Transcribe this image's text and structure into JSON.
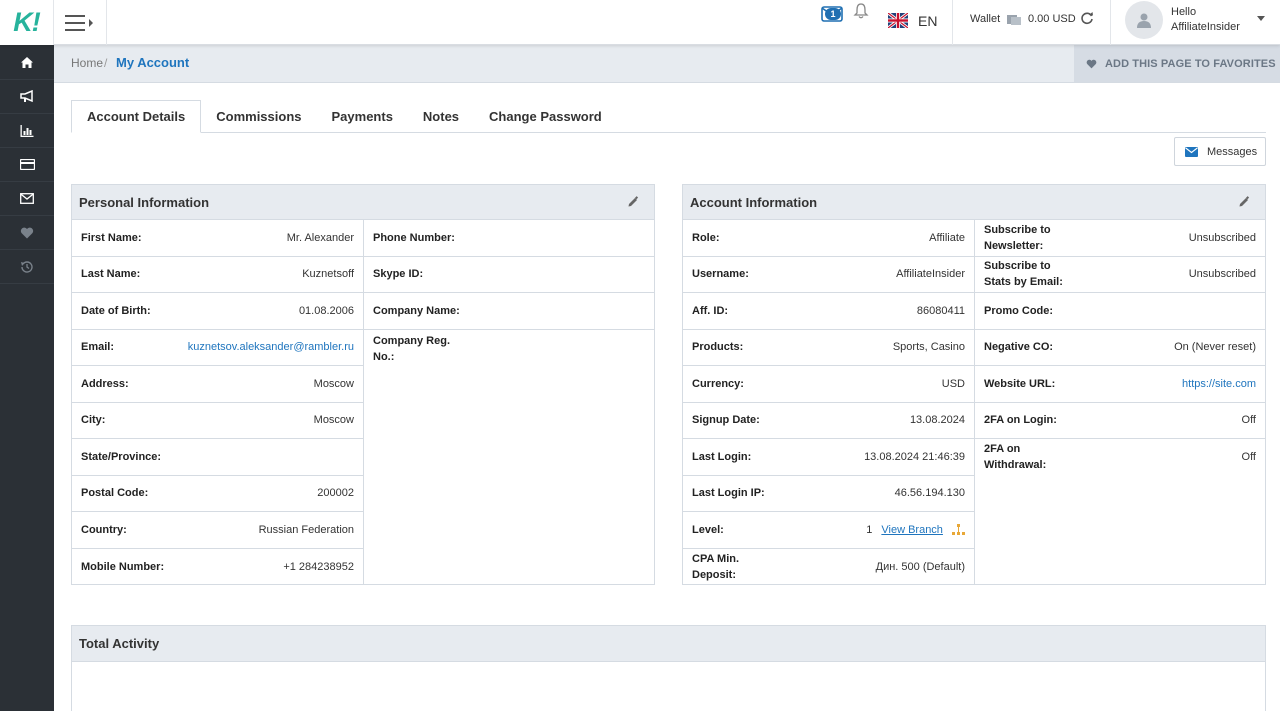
{
  "logo": {
    "text": "K!"
  },
  "topbar": {
    "messages_count": "1",
    "language": "EN",
    "wallet_label": "Wallet",
    "wallet_value": "0.00 USD",
    "greeting": "Hello",
    "username": "AffiliateInsider"
  },
  "sidebar": {
    "items": [
      {
        "icon": "home-icon"
      },
      {
        "icon": "megaphone-icon"
      },
      {
        "icon": "bar-chart-icon"
      },
      {
        "icon": "credit-card-icon"
      },
      {
        "icon": "envelope-icon"
      },
      {
        "icon": "heart-icon"
      },
      {
        "icon": "history-icon"
      }
    ]
  },
  "breadcrumb": {
    "home": "Home",
    "separator": "/",
    "current": "My Account"
  },
  "favorites_button": "ADD THIS PAGE TO FAVORITES",
  "tabs": [
    {
      "label": "Account Details",
      "active": true
    },
    {
      "label": "Commissions"
    },
    {
      "label": "Payments"
    },
    {
      "label": "Notes"
    },
    {
      "label": "Change Password"
    }
  ],
  "messages_button": "Messages",
  "personal": {
    "title": "Personal Information",
    "left": [
      {
        "k": "First Name:",
        "v": "Mr. Alexander"
      },
      {
        "k": "Last Name:",
        "v": "Kuznetsoff"
      },
      {
        "k": "Date of Birth:",
        "v": "01.08.2006"
      },
      {
        "k": "Email:",
        "v": "kuznetsov.aleksander@rambler.ru"
      },
      {
        "k": "Address:",
        "v": "Moscow"
      },
      {
        "k": "City:",
        "v": "Moscow"
      },
      {
        "k": "State/Province:",
        "v": ""
      },
      {
        "k": "Postal Code:",
        "v": "200002"
      },
      {
        "k": "Country:",
        "v": "Russian Federation"
      },
      {
        "k": "Mobile Number:",
        "v": "+1 284238952"
      }
    ],
    "right": [
      {
        "k": "Phone Number:",
        "v": ""
      },
      {
        "k": "Skype ID:",
        "v": ""
      },
      {
        "k": "Company Name:",
        "v": ""
      },
      {
        "k": "Company Reg. No.:",
        "v": ""
      }
    ]
  },
  "account": {
    "title": "Account Information",
    "left": [
      {
        "k": "Role:",
        "v": "Affiliate"
      },
      {
        "k": "Username:",
        "v": "AffiliateInsider"
      },
      {
        "k": "Aff. ID:",
        "v": "86080411"
      },
      {
        "k": "Products:",
        "v": "Sports, Casino"
      },
      {
        "k": "Currency:",
        "v": "USD"
      },
      {
        "k": "Signup Date:",
        "v": "13.08.2024"
      },
      {
        "k": "Last Login:",
        "v": "13.08.2024 21:46:39"
      },
      {
        "k": "Last Login IP:",
        "v": "46.56.194.130"
      },
      {
        "k": "Level:",
        "v": "1",
        "link": "View Branch"
      },
      {
        "k": "CPA Min. Deposit:",
        "v": "Дин. 500 (Default)"
      }
    ],
    "right": [
      {
        "k": "Subscribe to Newsletter:",
        "v": "Unsubscribed"
      },
      {
        "k": "Subscribe to Stats by Email:",
        "v": "Unsubscribed"
      },
      {
        "k": "Promo Code:",
        "v": ""
      },
      {
        "k": "Negative CO:",
        "v": "On (Never reset)"
      },
      {
        "k": "Website URL:",
        "v": "https://site.com"
      },
      {
        "k": "2FA on Login:",
        "v": "Off"
      },
      {
        "k": "2FA on Withdrawal:",
        "v": "Off"
      }
    ]
  },
  "total_activity": {
    "title": "Total Activity"
  },
  "colors": {
    "brand": "#27b39c",
    "link": "#1f75be",
    "sidebar": "#2b3036"
  }
}
